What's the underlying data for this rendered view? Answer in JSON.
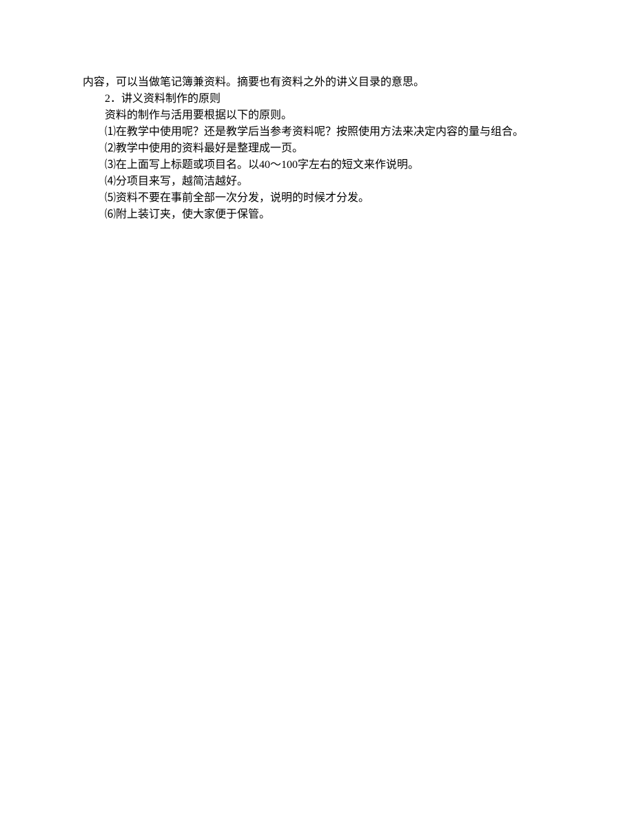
{
  "lines": {
    "l1": "内容，可以当做笔记簿兼资料。摘要也有资料之外的讲义目录的意思。",
    "l2": "2．讲义资料制作的原则",
    "l3": "资料的制作与活用要根据以下的原则。",
    "l4": "⑴在教学中使用呢？还是教学后当参考资料呢？按照使用方法来决定内容的量与组合。",
    "l5": "⑵教学中使用的资料最好是整理成一页。",
    "l6": "⑶在上面写上标题或项目名。以40～100字左右的短文来作说明。",
    "l7": "⑷分项目来写，越简洁越好。",
    "l8": "⑸资料不要在事前全部一次分发，说明的时候才分发。",
    "l9": "⑹附上装订夹，使大家便于保管。"
  }
}
